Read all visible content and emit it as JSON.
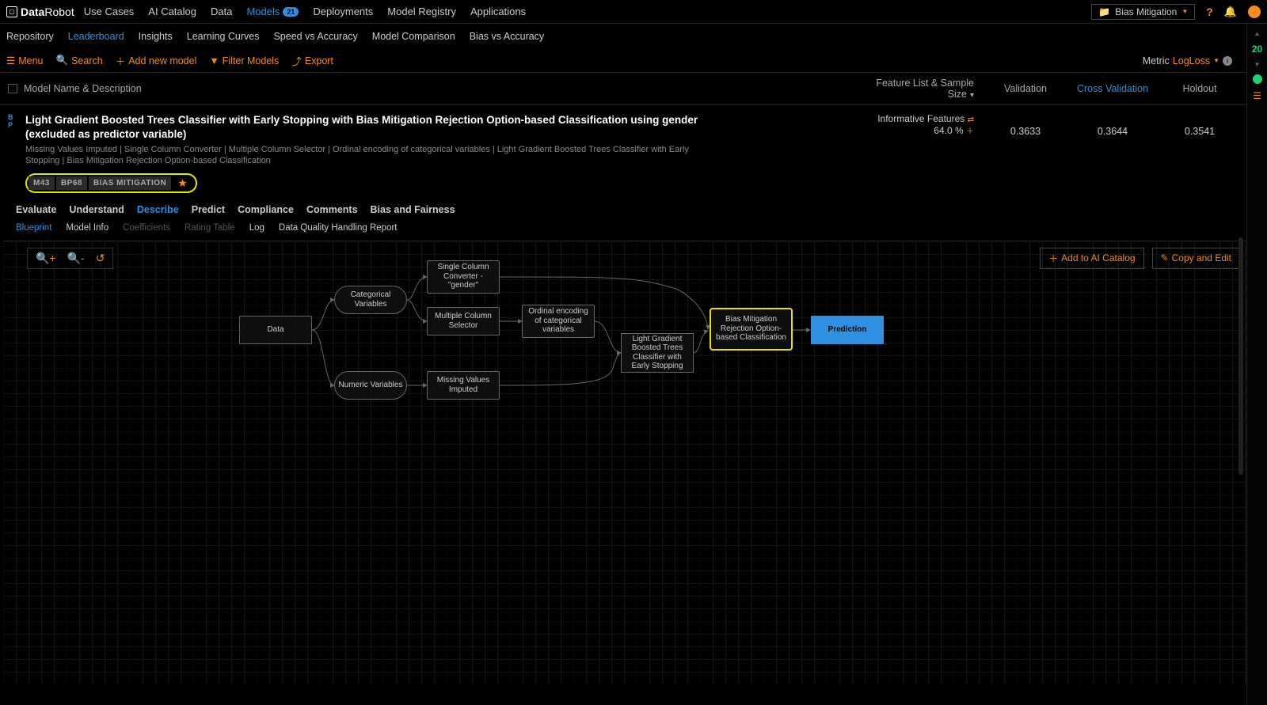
{
  "brand": {
    "bold": "Data",
    "light": "Robot"
  },
  "topnav": {
    "items": [
      {
        "label": "Use Cases"
      },
      {
        "label": "AI Catalog"
      },
      {
        "label": "Data"
      },
      {
        "label": "Models",
        "badge": "21",
        "active": true
      },
      {
        "label": "Deployments"
      },
      {
        "label": "Model Registry"
      },
      {
        "label": "Applications"
      }
    ],
    "project": "Bias Mitigation"
  },
  "subnav": [
    {
      "label": "Repository"
    },
    {
      "label": "Leaderboard",
      "active": true
    },
    {
      "label": "Insights"
    },
    {
      "label": "Learning Curves"
    },
    {
      "label": "Speed vs Accuracy"
    },
    {
      "label": "Model Comparison"
    },
    {
      "label": "Bias vs Accuracy"
    }
  ],
  "toolbar": {
    "menu": "Menu",
    "search": "Search",
    "add": "Add new model",
    "filter": "Filter Models",
    "export": "Export",
    "metric_label": "Metric",
    "metric_value": "LogLoss"
  },
  "columns": {
    "name": "Model Name & Description",
    "feature": "Feature List & Sample Size",
    "validation": "Validation",
    "cross": "Cross Validation",
    "holdout": "Holdout"
  },
  "model": {
    "title": "Light Gradient Boosted Trees Classifier with Early Stopping with Bias Mitigation Rejection Option-based Classification using gender (excluded as predictor variable)",
    "desc": "Missing Values Imputed | Single Column Converter | Multiple Column Selector | Ordinal encoding of categorical variables | Light Gradient Boosted Trees Classifier with Early Stopping | Bias Mitigation Rejection Option-based Classification",
    "tags": {
      "m": "M43",
      "bp": "BP68",
      "label": "BIAS MITIGATION"
    },
    "feature_list": "Informative Features",
    "sample_pct": "64.0 %",
    "validation": "0.3633",
    "cross": "0.3644",
    "holdout": "0.3541"
  },
  "tabs": [
    {
      "label": "Evaluate"
    },
    {
      "label": "Understand"
    },
    {
      "label": "Describe",
      "active": true
    },
    {
      "label": "Predict"
    },
    {
      "label": "Compliance"
    },
    {
      "label": "Comments"
    },
    {
      "label": "Bias and Fairness"
    }
  ],
  "subtabs": [
    {
      "label": "Blueprint",
      "active": true
    },
    {
      "label": "Model Info"
    },
    {
      "label": "Coefficients",
      "disabled": true
    },
    {
      "label": "Rating Table",
      "disabled": true
    },
    {
      "label": "Log"
    },
    {
      "label": "Data Quality Handling Report"
    }
  ],
  "bp_actions": {
    "add": "Add to AI Catalog",
    "copy": "Copy and Edit"
  },
  "nodes": {
    "data": "Data",
    "cat": "Categorical Variables",
    "num": "Numeric Variables",
    "scc": "Single Column Converter - \"gender\"",
    "mcs": "Multiple Column Selector",
    "ord": "Ordinal encoding of categorical variables",
    "mvi": "Missing Values Imputed",
    "lgbt": "Light Gradient Boosted Trees Classifier with Early Stopping",
    "bias": "Bias Mitigation Rejection Option-based Classification",
    "pred": "Prediction"
  },
  "rail": {
    "count": "20"
  }
}
